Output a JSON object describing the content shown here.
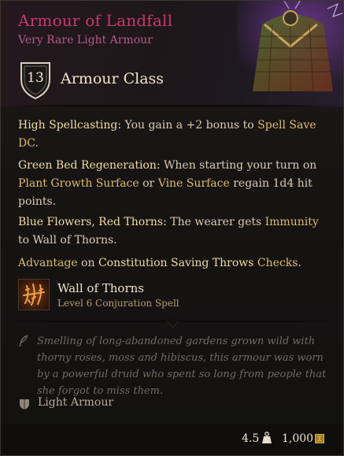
{
  "item": {
    "name": "Armour of Landfall",
    "rarity_type": "Very Rare Light Armour",
    "armour_class_value": "13",
    "armour_class_label": "Armour Class"
  },
  "properties": [
    {
      "title": "High Spellcasting:",
      "text_a": " You gain a +2 bonus to ",
      "hl_a": "Spell Save DC",
      "text_b": "."
    },
    {
      "title": "Green Bed Regeneration:",
      "text_a": " When starting your turn on ",
      "hl_a": "Plant Growth Surface",
      "text_b": " or ",
      "hl_b": "Vine Surface",
      "text_c": " regain 1d4 hit points."
    },
    {
      "title": "Blue Flowers, Red Thorns:",
      "text_a": " The wearer gets ",
      "hl_a": "Immunity",
      "text_b": " to Wall of Thorns."
    },
    {
      "hl_a": "Advantage",
      "text_a": " on ",
      "gold_a": "Constitution Saving Throws",
      "text_b": " ",
      "hl_b": "Checks",
      "text_c": "."
    }
  ],
  "spell": {
    "icon": "wall-of-thorns-icon",
    "name": "Wall of Thorns",
    "subtitle": "Level 6 Conjuration Spell"
  },
  "flavour": {
    "icon": "quill-icon",
    "text": "Smelling of long-abandoned gardens grown wild with thorny roses, moss and hibiscus, this armour was worn by a powerful druid who spent so long from people that she forgot to miss them."
  },
  "armour_type": {
    "icon": "light-armour-icon",
    "label": "Light Armour"
  },
  "footer": {
    "weight": "4.5",
    "weight_icon": "weight-icon",
    "price": "1,000",
    "price_icon": "gold-coin-icon"
  },
  "colors": {
    "name": "#c9376f",
    "rarity": "#b25a87",
    "highlight": "#e0bb6b",
    "bold": "#f1dc9f",
    "flavour": "#6f6a63"
  }
}
